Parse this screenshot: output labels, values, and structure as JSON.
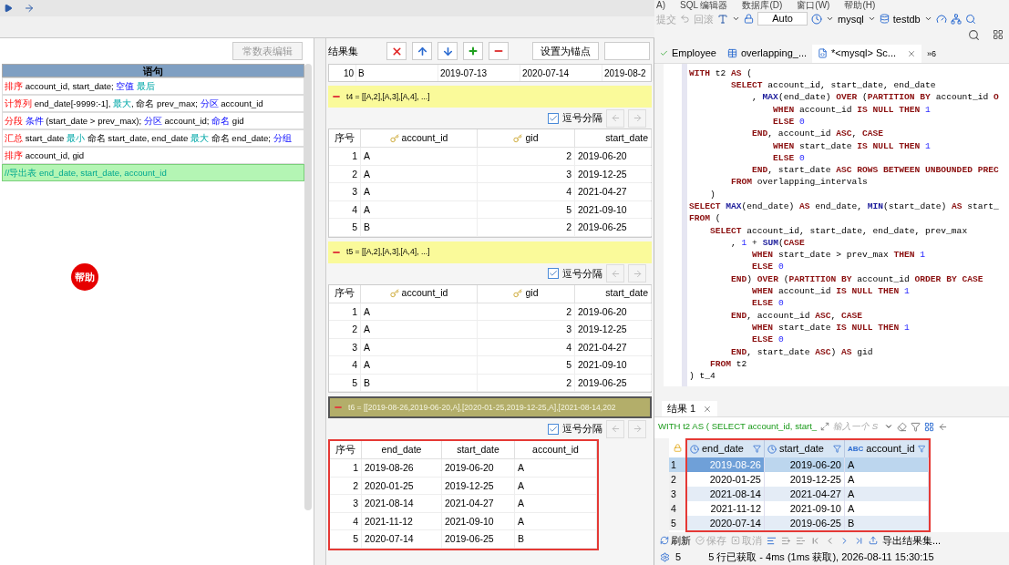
{
  "script_panel": {
    "button": "常数表编辑",
    "column": "语句",
    "rows": [
      {
        "selected": false,
        "tokens": [
          {
            "kind": "cmd",
            "text": "排序"
          },
          {
            "kind": "txt",
            "text": " account_id, start_date; "
          },
          {
            "kind": "opt",
            "text": "空值 "
          },
          {
            "kind": "fn",
            "text": "最后"
          }
        ]
      },
      {
        "selected": false,
        "tokens": [
          {
            "kind": "cmd",
            "text": "计算列"
          },
          {
            "kind": "txt",
            "text": " end_date[-9999:-1], "
          },
          {
            "kind": "fn",
            "text": "最大"
          },
          {
            "kind": "txt",
            "text": ", 命名 prev_max; "
          },
          {
            "kind": "opt",
            "text": "分区"
          },
          {
            "kind": "txt",
            "text": " account_id"
          }
        ]
      },
      {
        "selected": false,
        "tokens": [
          {
            "kind": "cmd",
            "text": "分段 "
          },
          {
            "kind": "opt",
            "text": "条件"
          },
          {
            "kind": "txt",
            "text": " (start_date > prev_max); "
          },
          {
            "kind": "opt",
            "text": "分区"
          },
          {
            "kind": "txt",
            "text": " account_id; "
          },
          {
            "kind": "opt",
            "text": "命名"
          },
          {
            "kind": "txt",
            "text": " gid"
          }
        ]
      },
      {
        "selected": false,
        "tokens": [
          {
            "kind": "cmd",
            "text": "汇总"
          },
          {
            "kind": "txt",
            "text": " start_date "
          },
          {
            "kind": "fn",
            "text": "最小"
          },
          {
            "kind": "txt",
            "text": " 命名 start_date, end_date "
          },
          {
            "kind": "fn",
            "text": "最大"
          },
          {
            "kind": "txt",
            "text": " 命名 end_date; "
          },
          {
            "kind": "opt",
            "text": "分组"
          }
        ]
      },
      {
        "selected": false,
        "tokens": [
          {
            "kind": "cmd",
            "text": "排序"
          },
          {
            "kind": "txt",
            "text": " account_id, gid"
          }
        ]
      },
      {
        "selected": true,
        "tokens": [
          {
            "kind": "comment",
            "text": "//导出表 end_date, start_date, account_id"
          }
        ]
      }
    ]
  },
  "help_badge": "帮助",
  "result_panel": {
    "title": "结果集",
    "anchor_button": "设置为锚点",
    "partial_row": [
      "10",
      "B",
      "2019-07-13",
      "2020-07-14",
      "2019-08-2"
    ],
    "sections": [
      {
        "label": "t4 = [[A,2],[A,3],[A,4], ...]",
        "selected": false,
        "highlighted": false,
        "comma_label": "逗号分隔",
        "comma_checked": true,
        "columns": [
          {
            "name": "序号",
            "kind": "index",
            "key": false
          },
          {
            "name": "account_id",
            "kind": "text",
            "key": true
          },
          {
            "name": "gid",
            "kind": "number",
            "key": true
          },
          {
            "name": "start_date",
            "kind": "text",
            "key": false
          }
        ],
        "rows": [
          [
            "1",
            "A",
            "2",
            "2019-06-20"
          ],
          [
            "2",
            "A",
            "3",
            "2019-12-25"
          ],
          [
            "3",
            "A",
            "4",
            "2021-04-27"
          ],
          [
            "4",
            "A",
            "5",
            "2021-09-10"
          ],
          [
            "5",
            "B",
            "2",
            "2019-06-25"
          ]
        ]
      },
      {
        "label": "t5 = [[A,2],[A,3],[A,4], ...]",
        "selected": false,
        "highlighted": false,
        "comma_label": "逗号分隔",
        "comma_checked": true,
        "columns": [
          {
            "name": "序号",
            "kind": "index",
            "key": false
          },
          {
            "name": "account_id",
            "kind": "text",
            "key": true
          },
          {
            "name": "gid",
            "kind": "number",
            "key": true
          },
          {
            "name": "start_date",
            "kind": "text",
            "key": false
          }
        ],
        "rows": [
          [
            "1",
            "A",
            "2",
            "2019-06-20"
          ],
          [
            "2",
            "A",
            "3",
            "2019-12-25"
          ],
          [
            "3",
            "A",
            "4",
            "2021-04-27"
          ],
          [
            "4",
            "A",
            "5",
            "2021-09-10"
          ],
          [
            "5",
            "B",
            "2",
            "2019-06-25"
          ]
        ]
      },
      {
        "label": "t6 = [[2019-08-26,2019-06-20,A],[2020-01-25,2019-12-25,A],[2021-08-14,202",
        "selected": true,
        "highlighted": true,
        "comma_label": "逗号分隔",
        "comma_checked": true,
        "columns": [
          {
            "name": "序号",
            "kind": "index",
            "key": false
          },
          {
            "name": "end_date",
            "kind": "text",
            "key": false
          },
          {
            "name": "start_date",
            "kind": "text",
            "key": false
          },
          {
            "name": "account_id",
            "kind": "text",
            "key": false
          }
        ],
        "rows": [
          [
            "1",
            "2019-08-26",
            "2019-06-20",
            "A"
          ],
          [
            "2",
            "2020-01-25",
            "2019-12-25",
            "A"
          ],
          [
            "3",
            "2021-08-14",
            "2021-04-27",
            "A"
          ],
          [
            "4",
            "2021-11-12",
            "2021-09-10",
            "A"
          ],
          [
            "5",
            "2020-07-14",
            "2019-06-25",
            "B"
          ]
        ]
      }
    ]
  },
  "ide": {
    "menu": [
      "A)",
      "SQL 编辑器",
      "数据库(D)",
      "窗口(W)",
      "帮助(H)"
    ],
    "toolbar": {
      "commit": "提交",
      "rollback": "回滚",
      "mode": "Auto",
      "connection": "mysql",
      "database": "testdb"
    },
    "tabs": [
      {
        "label": "Employee",
        "selected": false
      },
      {
        "label": "overlapping_...",
        "selected": false
      },
      {
        "label": "*<mysql> Sc...",
        "selected": true
      }
    ],
    "more_tabs": "»6",
    "code": [
      [
        {
          "kind": "kw",
          "text": "WITH"
        },
        {
          "kind": "p",
          "text": " t2 "
        },
        {
          "kind": "kw",
          "text": "AS"
        },
        {
          "kind": "p",
          "text": " ("
        }
      ],
      [
        {
          "kind": "kw",
          "text": "        SELECT"
        },
        {
          "kind": "p",
          "text": " account_id, start_date, end_date"
        }
      ],
      [
        {
          "kind": "p",
          "text": "            , "
        },
        {
          "kind": "fn",
          "text": "MAX"
        },
        {
          "kind": "p",
          "text": "(end_date) "
        },
        {
          "kind": "kw",
          "text": "OVER"
        },
        {
          "kind": "p",
          "text": " ("
        },
        {
          "kind": "kw",
          "text": "PARTITION BY"
        },
        {
          "kind": "p",
          "text": " account_id "
        },
        {
          "kind": "kw",
          "text": "O"
        }
      ],
      [
        {
          "kind": "kw",
          "text": "                WHEN"
        },
        {
          "kind": "p",
          "text": " account_id "
        },
        {
          "kind": "kw",
          "text": "IS NULL THEN "
        },
        {
          "kind": "num",
          "text": "1"
        }
      ],
      [
        {
          "kind": "kw",
          "text": "                ELSE "
        },
        {
          "kind": "num",
          "text": "0"
        }
      ],
      [
        {
          "kind": "kw",
          "text": "            END"
        },
        {
          "kind": "p",
          "text": ", account_id "
        },
        {
          "kind": "kw",
          "text": "ASC"
        },
        {
          "kind": "p",
          "text": ", "
        },
        {
          "kind": "kw",
          "text": "CASE"
        }
      ],
      [
        {
          "kind": "kw",
          "text": "                WHEN"
        },
        {
          "kind": "p",
          "text": " start_date "
        },
        {
          "kind": "kw",
          "text": "IS NULL THEN "
        },
        {
          "kind": "num",
          "text": "1"
        }
      ],
      [
        {
          "kind": "kw",
          "text": "                ELSE "
        },
        {
          "kind": "num",
          "text": "0"
        }
      ],
      [
        {
          "kind": "kw",
          "text": "            END"
        },
        {
          "kind": "p",
          "text": ", start_date "
        },
        {
          "kind": "kw",
          "text": "ASC ROWS BETWEEN UNBOUNDED PREC"
        }
      ],
      [
        {
          "kind": "kw",
          "text": "        FROM"
        },
        {
          "kind": "p",
          "text": " overlapping_intervals"
        }
      ],
      [
        {
          "kind": "p",
          "text": "    )"
        }
      ],
      [
        {
          "kind": "kw",
          "text": "SELECT "
        },
        {
          "kind": "fn",
          "text": "MAX"
        },
        {
          "kind": "p",
          "text": "(end_date) "
        },
        {
          "kind": "kw",
          "text": "AS"
        },
        {
          "kind": "p",
          "text": " end_date, "
        },
        {
          "kind": "fn",
          "text": "MIN"
        },
        {
          "kind": "p",
          "text": "(start_date) "
        },
        {
          "kind": "kw",
          "text": "AS"
        },
        {
          "kind": "p",
          "text": " start_"
        }
      ],
      [
        {
          "kind": "kw",
          "text": "FROM"
        },
        {
          "kind": "p",
          "text": " ("
        }
      ],
      [
        {
          "kind": "kw",
          "text": "    SELECT"
        },
        {
          "kind": "p",
          "text": " account_id, start_date, end_date, prev_max"
        }
      ],
      [
        {
          "kind": "p",
          "text": "        , "
        },
        {
          "kind": "num",
          "text": "1"
        },
        {
          "kind": "p",
          "text": " + "
        },
        {
          "kind": "fn",
          "text": "SUM"
        },
        {
          "kind": "p",
          "text": "("
        },
        {
          "kind": "kw",
          "text": "CASE"
        }
      ],
      [
        {
          "kind": "kw",
          "text": "            WHEN"
        },
        {
          "kind": "p",
          "text": " start_date > prev_max "
        },
        {
          "kind": "kw",
          "text": "THEN "
        },
        {
          "kind": "num",
          "text": "1"
        }
      ],
      [
        {
          "kind": "kw",
          "text": "            ELSE "
        },
        {
          "kind": "num",
          "text": "0"
        }
      ],
      [
        {
          "kind": "kw",
          "text": "        END"
        },
        {
          "kind": "p",
          "text": ") "
        },
        {
          "kind": "kw",
          "text": "OVER"
        },
        {
          "kind": "p",
          "text": " ("
        },
        {
          "kind": "kw",
          "text": "PARTITION BY"
        },
        {
          "kind": "p",
          "text": " account_id "
        },
        {
          "kind": "kw",
          "text": "ORDER BY CASE"
        }
      ],
      [
        {
          "kind": "kw",
          "text": "            WHEN"
        },
        {
          "kind": "p",
          "text": " account_id "
        },
        {
          "kind": "kw",
          "text": "IS NULL THEN "
        },
        {
          "kind": "num",
          "text": "1"
        }
      ],
      [
        {
          "kind": "kw",
          "text": "            ELSE "
        },
        {
          "kind": "num",
          "text": "0"
        }
      ],
      [
        {
          "kind": "kw",
          "text": "        END"
        },
        {
          "kind": "p",
          "text": ", account_id "
        },
        {
          "kind": "kw",
          "text": "ASC"
        },
        {
          "kind": "p",
          "text": ", "
        },
        {
          "kind": "kw",
          "text": "CASE"
        }
      ],
      [
        {
          "kind": "kw",
          "text": "            WHEN"
        },
        {
          "kind": "p",
          "text": " start_date "
        },
        {
          "kind": "kw",
          "text": "IS NULL THEN "
        },
        {
          "kind": "num",
          "text": "1"
        }
      ],
      [
        {
          "kind": "kw",
          "text": "            ELSE "
        },
        {
          "kind": "num",
          "text": "0"
        }
      ],
      [
        {
          "kind": "kw",
          "text": "        END"
        },
        {
          "kind": "p",
          "text": ", start_date "
        },
        {
          "kind": "kw",
          "text": "ASC"
        },
        {
          "kind": "p",
          "text": ") "
        },
        {
          "kind": "kw",
          "text": "AS"
        },
        {
          "kind": "p",
          "text": " gid"
        }
      ],
      [
        {
          "kind": "kw",
          "text": "    FROM"
        },
        {
          "kind": "p",
          "text": " t2"
        }
      ],
      [
        {
          "kind": "p",
          "text": ") t_4"
        }
      ]
    ],
    "result": {
      "tab": "结果 1",
      "query": "WITH t2 AS ( SELECT account_id, start_",
      "filter_placeholder": "输入一个 S",
      "columns": [
        {
          "name": "end_date",
          "kind": "date"
        },
        {
          "name": "start_date",
          "kind": "date"
        },
        {
          "name": "account_id",
          "kind": "text",
          "type_label": "ABC"
        }
      ],
      "rows": [
        {
          "num": "1",
          "cells": [
            "2019-08-26",
            "2019-06-20",
            "A"
          ],
          "selected": true
        },
        {
          "num": "2",
          "cells": [
            "2020-01-25",
            "2019-12-25",
            "A"
          ],
          "selected": false
        },
        {
          "num": "3",
          "cells": [
            "2021-08-14",
            "2021-04-27",
            "A"
          ],
          "selected": false
        },
        {
          "num": "4",
          "cells": [
            "2021-11-12",
            "2021-09-10",
            "A"
          ],
          "selected": false
        },
        {
          "num": "5",
          "cells": [
            "2020-07-14",
            "2019-06-25",
            "B"
          ],
          "selected": false
        }
      ],
      "highlighted": true,
      "actions": [
        {
          "label": "刷新",
          "disabled": false
        },
        {
          "label": "保存",
          "disabled": true
        },
        {
          "label": "取消",
          "disabled": true
        }
      ],
      "export": "导出结果集...",
      "fetch_size": "5",
      "status": "5 行已获取 - 4ms (1ms 获取), 2026-08-11 15:30:15"
    }
  }
}
